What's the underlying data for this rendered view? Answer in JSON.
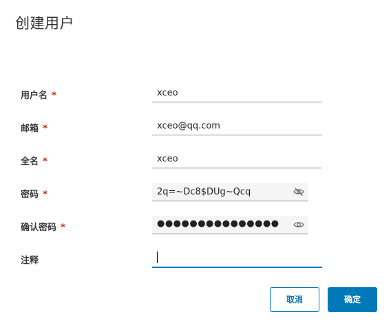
{
  "dialog": {
    "title": "创建用户"
  },
  "form": {
    "required_mark": "*",
    "username": {
      "label": "用户名",
      "value": "xceo"
    },
    "email": {
      "label": "邮箱",
      "value": "xceo@qq.com"
    },
    "fullname": {
      "label": "全名",
      "value": "xceo"
    },
    "password": {
      "label": "密码",
      "value": "2q=~Dc8$DUg~Qcq",
      "icon": "eye-slash-icon"
    },
    "confirm_password": {
      "label": "确认密码",
      "value": "●●●●●●●●●●●●●●●",
      "icon": "eye-icon"
    },
    "notes": {
      "label": "注释",
      "value": ""
    }
  },
  "buttons": {
    "cancel": "取消",
    "ok": "确定"
  },
  "colors": {
    "accent": "#0079b8",
    "required": "#c92100"
  }
}
